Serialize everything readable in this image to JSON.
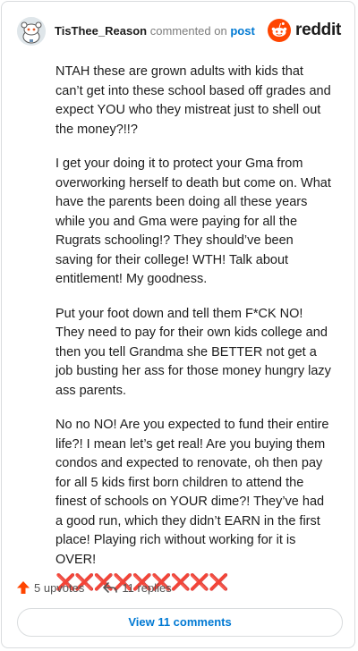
{
  "header": {
    "username": "TisThee_Reason",
    "action_text": "commented on",
    "post_link": "post",
    "brand": "reddit"
  },
  "comment": {
    "paragraphs": [
      "NTAH these are grown adults with kids that can’t get into these school based off grades and expect YOU who they mistreat just to shell out the money?!!?",
      "I get your doing it to protect your Gma from overworking herself to death but come on. What have the parents been doing all these years while you and Gma were paying for all the Rugrats schooling!? They should’ve been saving for their college! WTH! Talk about entitlement! My goodness.",
      "Put your foot down and tell them F*CK NO! They need to pay for their own kids college and then you tell Grandma she BETTER not get a job busting her ass for those money hungry lazy ass parents.",
      "No no NO! Are you expected to fund their entire life?! I mean let’s get real! Are you buying them condos and expected to renovate, oh then pay for all 5 kids first born children to attend the finest of schools on YOUR dime?! They’ve had a good run, which they didn’t EARN in the first place! Playing rich without working for it is OVER!"
    ],
    "emoji_row": "❌❌❌❌❌❌❌❌❌"
  },
  "actions": {
    "upvotes": "5 upvotes",
    "replies": "11 replies"
  },
  "view_comments_label": "View 11 comments",
  "colors": {
    "brand_orange": "#ff4500",
    "link_blue": "#0079d3",
    "x_red": "#d40000"
  }
}
